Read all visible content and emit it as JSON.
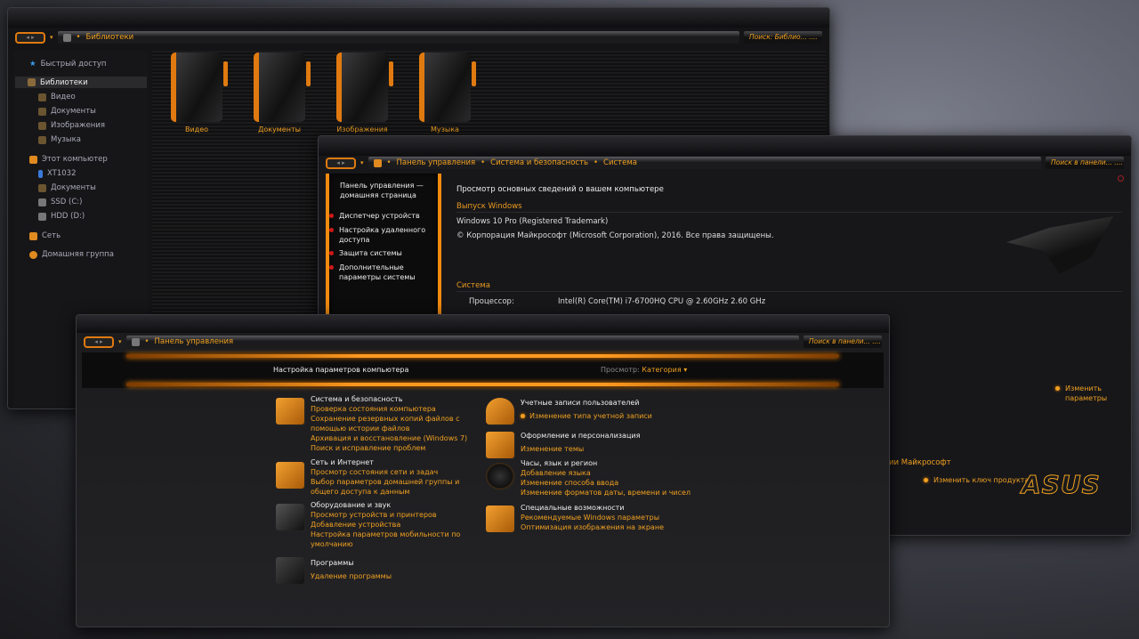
{
  "explorer": {
    "address": [
      "Библиотеки"
    ],
    "search_placeholder": "Поиск: Библио...",
    "search_dots": "....",
    "sidebar": [
      {
        "label": "Быстрый доступ"
      },
      {
        "label": "Библиотеки"
      },
      {
        "label": "Видео"
      },
      {
        "label": "Документы"
      },
      {
        "label": "Изображения"
      },
      {
        "label": "Музыка"
      },
      {
        "label": "Этот компьютер"
      },
      {
        "label": "XT1032"
      },
      {
        "label": "Документы"
      },
      {
        "label": "SSD (C:)"
      },
      {
        "label": "HDD (D:)"
      },
      {
        "label": "Сеть"
      },
      {
        "label": "Домашняя группа"
      }
    ],
    "libraries": [
      {
        "label": "Видео"
      },
      {
        "label": "Документы"
      },
      {
        "label": "Изображения"
      },
      {
        "label": "Музыка"
      }
    ]
  },
  "system": {
    "address": [
      "Панель управления",
      "Система и безопасность",
      "Система"
    ],
    "search_placeholder": "Поиск в панели...",
    "search_dots": "....",
    "left": {
      "home": "Панель управления — домашняя страница",
      "tasks": [
        "Диспетчер устройств",
        "Настройка удаленного доступа",
        "Защита системы",
        "Дополнительные параметры системы"
      ]
    },
    "title": "Просмотр основных сведений о вашем компьютере",
    "edition_header": "Выпуск Windows",
    "edition": "Windows 10 Pro (Registered Trademark)",
    "copyright": "© Корпорация Майкрософт (Microsoft Corporation), 2016. Все права защищены.",
    "system_header": "Система",
    "cpu_label": "Процессор:",
    "cpu_value": "Intel(R) Core(TM) i7-6700HQ CPU @ 2.60GHz   2.60 GHz",
    "change_settings": "Изменить параметры",
    "activation_partial": "ации Майкрософт",
    "change_key": "Изменить ключ продукта"
  },
  "control": {
    "address": [
      "Панель управления"
    ],
    "search_placeholder": "Поиск в панели...",
    "search_dots": "....",
    "heading": "Настройка параметров компьютера",
    "view_label": "Просмотр:",
    "view_value": "Категория",
    "categories": [
      {
        "title": "Система и безопасность",
        "links": [
          "Проверка состояния компьютера",
          "Сохранение резервных копий файлов с помощью истории файлов",
          "Архивация и восстановление (Windows 7)",
          "Поиск и исправление проблем"
        ]
      },
      {
        "title": "Сеть и Интернет",
        "links": [
          "Просмотр состояния сети и задач",
          "Выбор параметров домашней группы и общего доступа к данным"
        ]
      },
      {
        "title": "Оборудование и звук",
        "links": [
          "Просмотр устройств и принтеров",
          "Добавление устройства",
          "Настройка параметров мобильности по умолчанию"
        ]
      },
      {
        "title": "Программы",
        "links": [
          "Удаление программы"
        ]
      },
      {
        "title": "Учетные записи пользователей",
        "links": [
          "Изменение типа учетной записи"
        ]
      },
      {
        "title": "Оформление и персонализация",
        "links": [
          "Изменение темы"
        ]
      },
      {
        "title": "Часы, язык и регион",
        "links": [
          "Добавление языка",
          "Изменение способа ввода",
          "Изменение форматов даты, времени и чисел"
        ]
      },
      {
        "title": "Специальные возможности",
        "links": [
          "Рекомендуемые Windows параметры",
          "Оптимизация изображения на экране"
        ]
      }
    ]
  },
  "accent": "#f0a020"
}
